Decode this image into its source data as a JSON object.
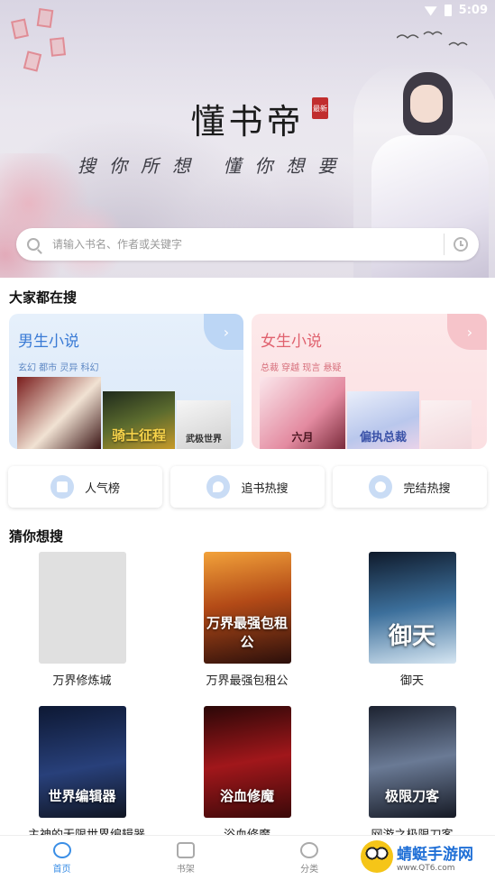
{
  "status": {
    "time": "5:09"
  },
  "hero": {
    "app_title": "懂书帝",
    "seal_text": "最新",
    "slogan": "搜你所想 懂你想要"
  },
  "search": {
    "placeholder": "请输入书名、作者或关键字"
  },
  "hot_search": {
    "title": "大家都在搜",
    "male": {
      "title": "男生小说",
      "tags": "玄幻 都市 灵异 科幻",
      "covers": [
        "",
        "骑士征程",
        "武极世界"
      ]
    },
    "female": {
      "title": "女生小说",
      "tags": "总裁 穿越 现言 悬疑",
      "covers": [
        "六月",
        "偏执总裁",
        ""
      ]
    }
  },
  "rank_buttons": [
    "人气榜",
    "追书热搜",
    "完结热搜"
  ],
  "guess": {
    "title": "猜你想搜",
    "books": [
      {
        "name": "万界修炼城",
        "cover_text": ""
      },
      {
        "name": "万界最强包租公",
        "cover_text": "万界最强包租公"
      },
      {
        "name": "御天",
        "cover_text": "御天"
      },
      {
        "name": "主神的无限世界编辑器",
        "cover_text": "世界编辑器"
      },
      {
        "name": "浴血修魔",
        "cover_text": "浴血修魔"
      },
      {
        "name": "网游之极限刀客",
        "cover_text": "极限刀客"
      }
    ]
  },
  "tabs": [
    "首页",
    "书架",
    "分类"
  ],
  "watermark": {
    "name": "蜻蜓手游网",
    "url": "www.QT6.com"
  }
}
